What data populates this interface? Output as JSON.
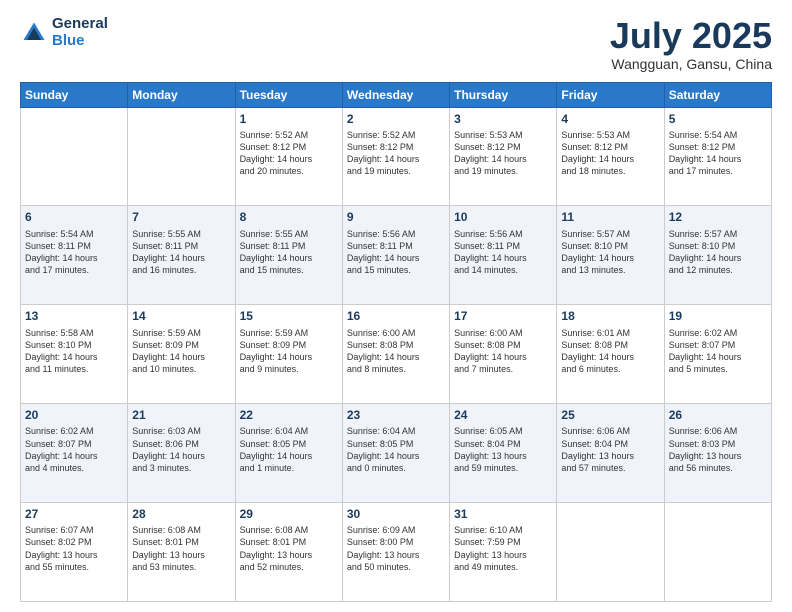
{
  "header": {
    "logo_general": "General",
    "logo_blue": "Blue",
    "month_title": "July 2025",
    "location": "Wangguan, Gansu, China"
  },
  "days_of_week": [
    "Sunday",
    "Monday",
    "Tuesday",
    "Wednesday",
    "Thursday",
    "Friday",
    "Saturday"
  ],
  "weeks": [
    [
      {
        "day": "",
        "info": ""
      },
      {
        "day": "",
        "info": ""
      },
      {
        "day": "1",
        "info": "Sunrise: 5:52 AM\nSunset: 8:12 PM\nDaylight: 14 hours\nand 20 minutes."
      },
      {
        "day": "2",
        "info": "Sunrise: 5:52 AM\nSunset: 8:12 PM\nDaylight: 14 hours\nand 19 minutes."
      },
      {
        "day": "3",
        "info": "Sunrise: 5:53 AM\nSunset: 8:12 PM\nDaylight: 14 hours\nand 19 minutes."
      },
      {
        "day": "4",
        "info": "Sunrise: 5:53 AM\nSunset: 8:12 PM\nDaylight: 14 hours\nand 18 minutes."
      },
      {
        "day": "5",
        "info": "Sunrise: 5:54 AM\nSunset: 8:12 PM\nDaylight: 14 hours\nand 17 minutes."
      }
    ],
    [
      {
        "day": "6",
        "info": "Sunrise: 5:54 AM\nSunset: 8:11 PM\nDaylight: 14 hours\nand 17 minutes."
      },
      {
        "day": "7",
        "info": "Sunrise: 5:55 AM\nSunset: 8:11 PM\nDaylight: 14 hours\nand 16 minutes."
      },
      {
        "day": "8",
        "info": "Sunrise: 5:55 AM\nSunset: 8:11 PM\nDaylight: 14 hours\nand 15 minutes."
      },
      {
        "day": "9",
        "info": "Sunrise: 5:56 AM\nSunset: 8:11 PM\nDaylight: 14 hours\nand 15 minutes."
      },
      {
        "day": "10",
        "info": "Sunrise: 5:56 AM\nSunset: 8:11 PM\nDaylight: 14 hours\nand 14 minutes."
      },
      {
        "day": "11",
        "info": "Sunrise: 5:57 AM\nSunset: 8:10 PM\nDaylight: 14 hours\nand 13 minutes."
      },
      {
        "day": "12",
        "info": "Sunrise: 5:57 AM\nSunset: 8:10 PM\nDaylight: 14 hours\nand 12 minutes."
      }
    ],
    [
      {
        "day": "13",
        "info": "Sunrise: 5:58 AM\nSunset: 8:10 PM\nDaylight: 14 hours\nand 11 minutes."
      },
      {
        "day": "14",
        "info": "Sunrise: 5:59 AM\nSunset: 8:09 PM\nDaylight: 14 hours\nand 10 minutes."
      },
      {
        "day": "15",
        "info": "Sunrise: 5:59 AM\nSunset: 8:09 PM\nDaylight: 14 hours\nand 9 minutes."
      },
      {
        "day": "16",
        "info": "Sunrise: 6:00 AM\nSunset: 8:08 PM\nDaylight: 14 hours\nand 8 minutes."
      },
      {
        "day": "17",
        "info": "Sunrise: 6:00 AM\nSunset: 8:08 PM\nDaylight: 14 hours\nand 7 minutes."
      },
      {
        "day": "18",
        "info": "Sunrise: 6:01 AM\nSunset: 8:08 PM\nDaylight: 14 hours\nand 6 minutes."
      },
      {
        "day": "19",
        "info": "Sunrise: 6:02 AM\nSunset: 8:07 PM\nDaylight: 14 hours\nand 5 minutes."
      }
    ],
    [
      {
        "day": "20",
        "info": "Sunrise: 6:02 AM\nSunset: 8:07 PM\nDaylight: 14 hours\nand 4 minutes."
      },
      {
        "day": "21",
        "info": "Sunrise: 6:03 AM\nSunset: 8:06 PM\nDaylight: 14 hours\nand 3 minutes."
      },
      {
        "day": "22",
        "info": "Sunrise: 6:04 AM\nSunset: 8:05 PM\nDaylight: 14 hours\nand 1 minute."
      },
      {
        "day": "23",
        "info": "Sunrise: 6:04 AM\nSunset: 8:05 PM\nDaylight: 14 hours\nand 0 minutes."
      },
      {
        "day": "24",
        "info": "Sunrise: 6:05 AM\nSunset: 8:04 PM\nDaylight: 13 hours\nand 59 minutes."
      },
      {
        "day": "25",
        "info": "Sunrise: 6:06 AM\nSunset: 8:04 PM\nDaylight: 13 hours\nand 57 minutes."
      },
      {
        "day": "26",
        "info": "Sunrise: 6:06 AM\nSunset: 8:03 PM\nDaylight: 13 hours\nand 56 minutes."
      }
    ],
    [
      {
        "day": "27",
        "info": "Sunrise: 6:07 AM\nSunset: 8:02 PM\nDaylight: 13 hours\nand 55 minutes."
      },
      {
        "day": "28",
        "info": "Sunrise: 6:08 AM\nSunset: 8:01 PM\nDaylight: 13 hours\nand 53 minutes."
      },
      {
        "day": "29",
        "info": "Sunrise: 6:08 AM\nSunset: 8:01 PM\nDaylight: 13 hours\nand 52 minutes."
      },
      {
        "day": "30",
        "info": "Sunrise: 6:09 AM\nSunset: 8:00 PM\nDaylight: 13 hours\nand 50 minutes."
      },
      {
        "day": "31",
        "info": "Sunrise: 6:10 AM\nSunset: 7:59 PM\nDaylight: 13 hours\nand 49 minutes."
      },
      {
        "day": "",
        "info": ""
      },
      {
        "day": "",
        "info": ""
      }
    ]
  ]
}
